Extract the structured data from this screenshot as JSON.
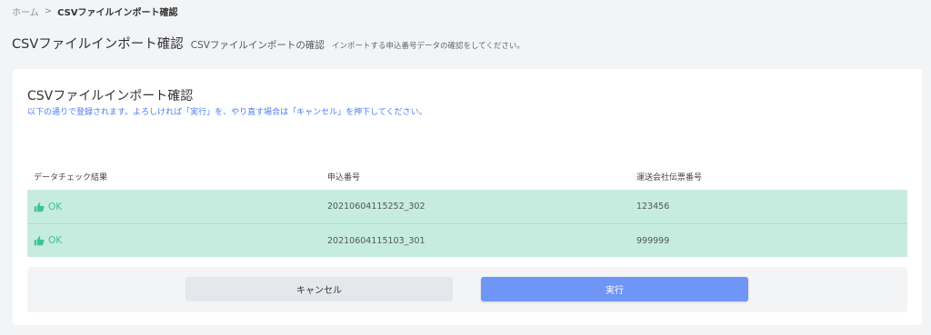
{
  "breadcrumb": {
    "home": "ホーム",
    "separator": ">",
    "current": "CSVファイルインポート確認"
  },
  "header": {
    "title": "CSVファイルインポート確認",
    "subtitle": "CSVファイルインポートの確認",
    "description": "インポートする申込番号データの確認をしてください。"
  },
  "card": {
    "title": "CSVファイルインポート確認",
    "description": "以下の通りで登録されます。よろしければ「実行」を、やり直す場合は「キャンセル」を押下してください。"
  },
  "table": {
    "columns": [
      "データチェック結果",
      "申込番号",
      "運送会社伝票番号"
    ],
    "rows": [
      {
        "status": "OK",
        "status_icon": "thumbs-up-icon",
        "application_no": "20210604115252_302",
        "slip_no": "123456"
      },
      {
        "status": "OK",
        "status_icon": "thumbs-up-icon",
        "application_no": "20210604115103_301",
        "slip_no": "999999"
      }
    ]
  },
  "actions": {
    "cancel_label": "キャンセル",
    "execute_label": "実行"
  },
  "colors": {
    "accent": "#6f96f6",
    "ok_text": "#3ec48e",
    "row_bg": "#c6ece0",
    "description_text": "#4d7cf0"
  }
}
